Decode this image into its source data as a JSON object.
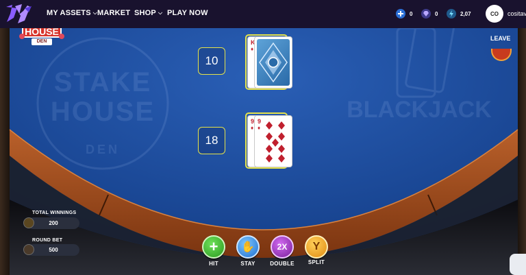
{
  "colors": {
    "nav_bg": "#19122e",
    "felt": "#1e4a9a",
    "felt_dark": "#0f2f6e",
    "wood": "#a14b1f",
    "highlight": "#e6e34a",
    "hit": "#3bb52b",
    "stay": "#2f8fe0",
    "double": "#9b2fb8",
    "split": "#f0a020"
  },
  "nav": {
    "logo_icon": "brand-logo-icon",
    "items": [
      {
        "label": "MY ASSETS",
        "has_chevron": true
      },
      {
        "label": "MARKET",
        "has_chevron": false
      },
      {
        "label": "SHOP",
        "has_chevron": true
      },
      {
        "label": "PLAY NOW",
        "has_chevron": false
      }
    ],
    "stats": [
      {
        "icon": "plus-token-icon",
        "value": "0"
      },
      {
        "icon": "gem-icon",
        "value": "0"
      },
      {
        "icon": "energy-icon",
        "value": "2,07"
      }
    ],
    "avatar_initials": "CO",
    "username": "cositav"
  },
  "table": {
    "brand_logo_text": [
      "STAKE",
      "HOUSE",
      "DEN"
    ],
    "watermark_left": [
      "STAKE",
      "HOUSE",
      "DEN"
    ],
    "watermark_right": "BLACKJACK",
    "leave_label": "LEAVE",
    "dealer": {
      "total": "10",
      "cards": [
        {
          "rank": "K",
          "suit": "♦",
          "face_down": false
        },
        {
          "rank": "",
          "suit": "",
          "face_down": true
        }
      ]
    },
    "player": {
      "total": "18",
      "cards": [
        {
          "rank": "9",
          "suit": "♦"
        },
        {
          "rank": "9",
          "suit": "♦"
        }
      ]
    }
  },
  "panel": {
    "total_winnings_label": "TOTAL WINNINGS",
    "total_winnings_value": "200",
    "round_bet_label": "ROUND BET",
    "round_bet_value": "500"
  },
  "actions": [
    {
      "label": "HIT",
      "glyph": "+",
      "icon": "plus-icon"
    },
    {
      "label": "STAY",
      "glyph": "✋",
      "icon": "hand-icon"
    },
    {
      "label": "DOUBLE",
      "glyph": "2X",
      "icon": "double-icon"
    },
    {
      "label": "SPLIT",
      "glyph": "Y",
      "icon": "split-icon"
    }
  ]
}
